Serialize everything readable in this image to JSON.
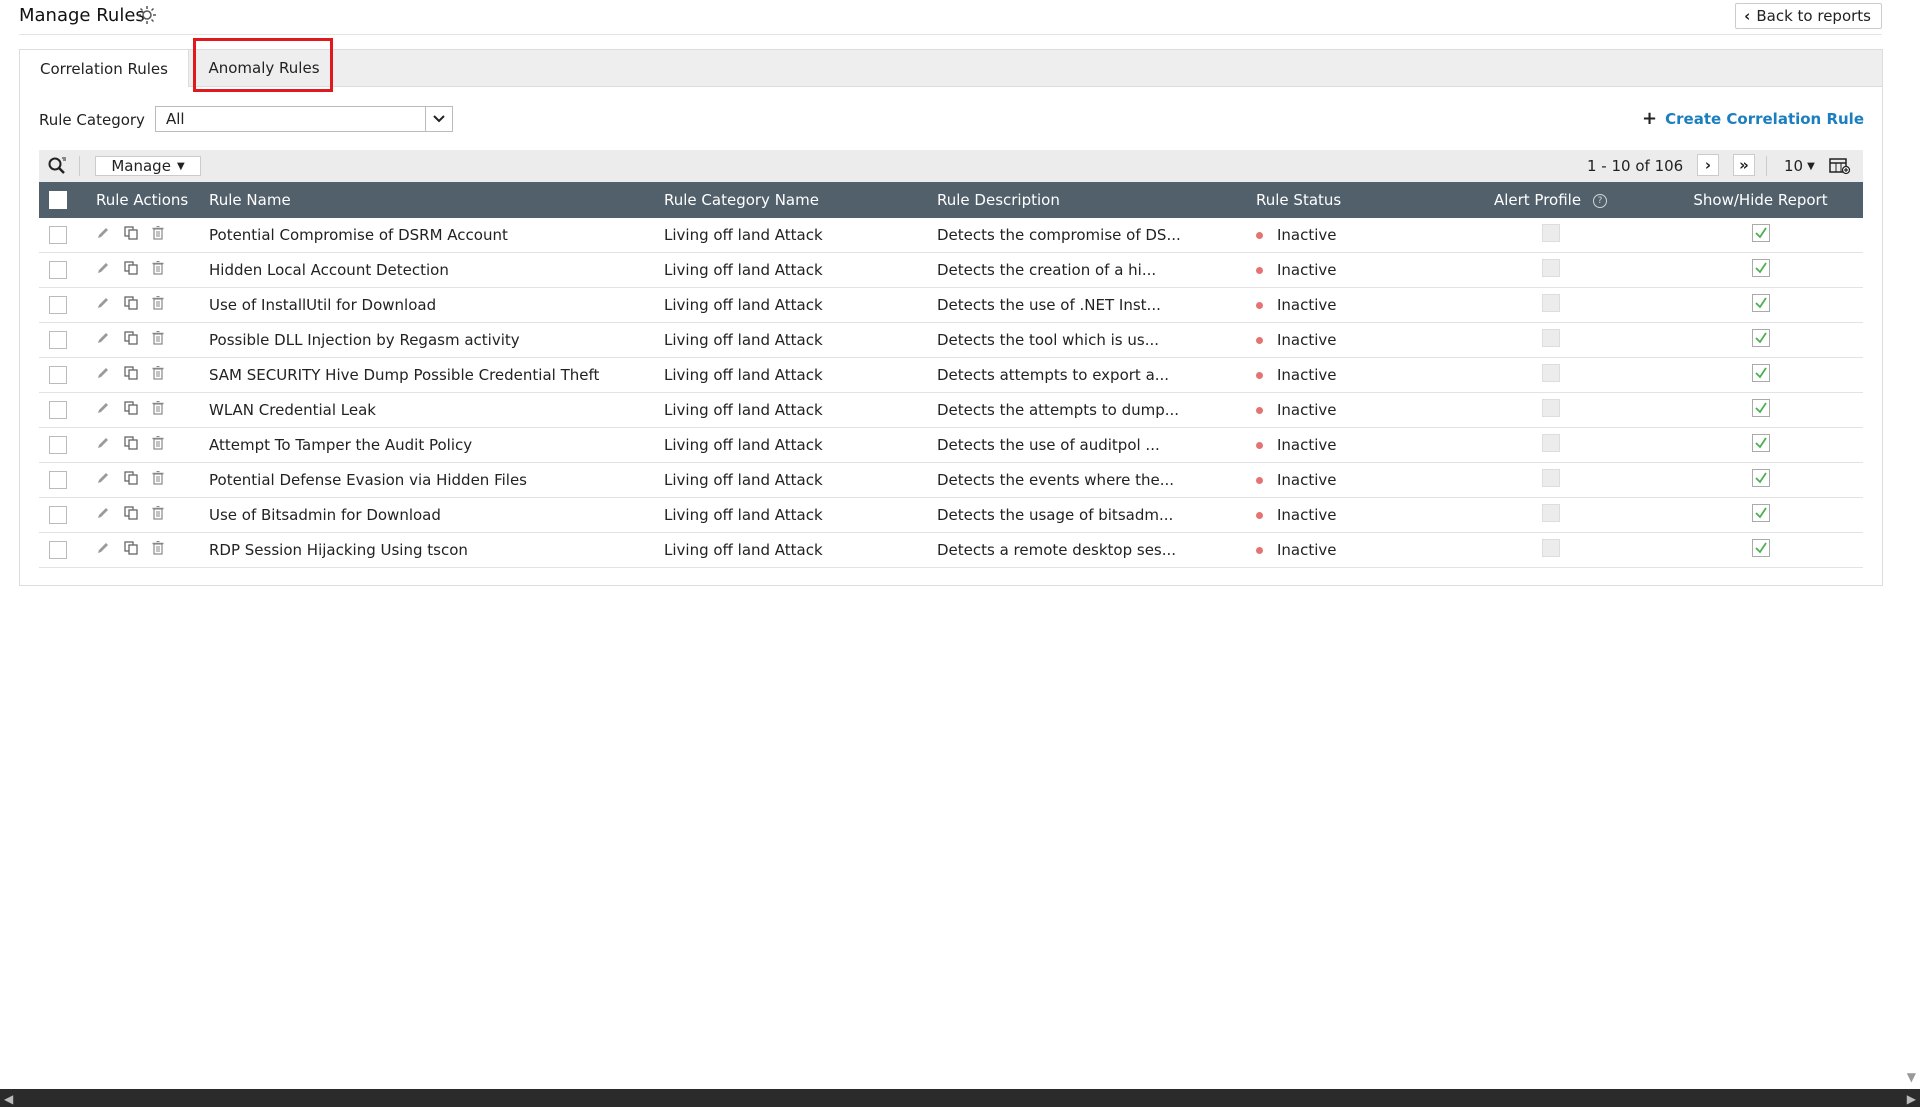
{
  "header": {
    "title": "Manage Rules",
    "back_label": "Back to reports"
  },
  "tabs": {
    "correlation": "Correlation Rules",
    "anomaly": "Anomaly Rules"
  },
  "filter": {
    "label": "Rule Category",
    "selected": "All"
  },
  "create_label": "Create Correlation Rule",
  "toolbar": {
    "manage_label": "Manage",
    "page_range": "1 - 10 of 106",
    "page_size": "10"
  },
  "table": {
    "headers": {
      "actions": "Rule Actions",
      "name": "Rule Name",
      "category": "Rule Category Name",
      "description": "Rule Description",
      "status": "Rule Status",
      "alert": "Alert Profile",
      "show": "Show/Hide Report"
    },
    "rows": [
      {
        "name": "Potential Compromise of DSRM Account",
        "category": "Living off land Attack",
        "description": "Detects the compromise of DS...",
        "status": "Inactive"
      },
      {
        "name": "Hidden Local Account Detection",
        "category": "Living off land Attack",
        "description": "Detects the creation of a hi...",
        "status": "Inactive"
      },
      {
        "name": "Use of InstallUtil for Download",
        "category": "Living off land Attack",
        "description": "Detects the use of .NET Inst...",
        "status": "Inactive"
      },
      {
        "name": "Possible DLL Injection by Regasm activity",
        "category": "Living off land Attack",
        "description": "Detects the tool which is us...",
        "status": "Inactive"
      },
      {
        "name": "SAM SECURITY Hive Dump Possible Credential Theft",
        "category": "Living off land Attack",
        "description": "Detects attempts to export a...",
        "status": "Inactive"
      },
      {
        "name": "WLAN Credential Leak",
        "category": "Living off land Attack",
        "description": "Detects the attempts to dump...",
        "status": "Inactive"
      },
      {
        "name": "Attempt To Tamper the Audit Policy",
        "category": "Living off land Attack",
        "description": "Detects the use of auditpol ...",
        "status": "Inactive"
      },
      {
        "name": "Potential Defense Evasion via Hidden Files",
        "category": "Living off land Attack",
        "description": "Detects the events where the...",
        "status": "Inactive"
      },
      {
        "name": "Use of Bitsadmin for Download",
        "category": "Living off land Attack",
        "description": "Detects the usage of bitsadm...",
        "status": "Inactive"
      },
      {
        "name": "RDP Session Hijacking Using tscon",
        "category": "Living off land Attack",
        "description": "Detects a remote desktop ses...",
        "status": "Inactive"
      }
    ]
  },
  "colors": {
    "header_bg": "#52606b",
    "link": "#1b7ec0",
    "inactive_dot": "#e57373",
    "highlight": "#e0191f"
  }
}
